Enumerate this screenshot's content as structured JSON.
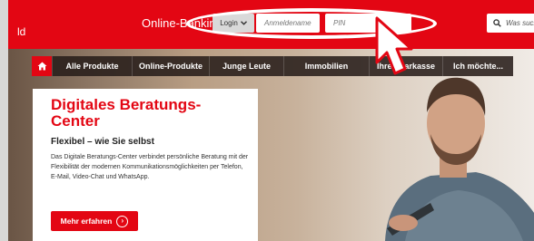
{
  "header": {
    "brand_fragment": "ld",
    "online_banking": "Online-Banking",
    "login_label": "Login",
    "username_placeholder": "Anmeldename",
    "pin_placeholder": "PIN",
    "search_placeholder": "Was such"
  },
  "nav": {
    "items": [
      "Alle Produkte",
      "Online-Produkte",
      "Junge Leute",
      "Immobilien",
      "Ihre Sparkasse",
      "Ich möchte..."
    ]
  },
  "hero": {
    "title": "Digitales Beratungs-Center",
    "subtitle": "Flexibel – wie Sie selbst",
    "body": "Das Digitale Beratungs-Center verbindet persönliche Beratung mit der Flexibilität der modernen Kommunikationsmöglichkeiten per Telefon, E-Mail, Video-Chat und WhatsApp.",
    "button": "Mehr erfahren"
  },
  "colors": {
    "brand_red": "#e30613",
    "nav_dark": "#2c211c"
  },
  "icons": [
    "home-icon",
    "chevron-down-icon",
    "search-icon",
    "arrow-right-icon",
    "cursor-icon"
  ]
}
